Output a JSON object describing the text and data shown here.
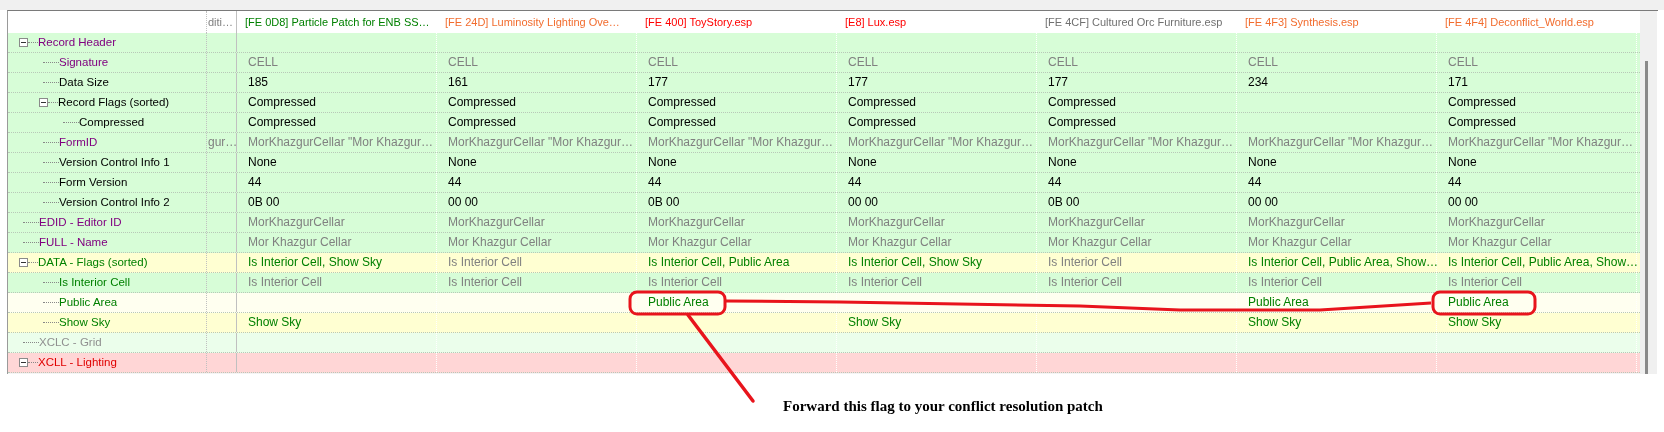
{
  "columns": [
    {
      "label": "diti…",
      "color": "#808080"
    },
    {
      "label": "[FE 0D8] Particle Patch for ENB SS…",
      "color": "#008000"
    },
    {
      "label": "[FE 24D] Luminosity Lighting Ove…",
      "color": "#f26c2e"
    },
    {
      "label": "[FE 400] ToyStory.esp",
      "color": "#ff0000"
    },
    {
      "label": "[E8] Lux.esp",
      "color": "#ff0000"
    },
    {
      "label": "[FE 4CF] Cultured Orc Furniture.esp",
      "color": "#707070"
    },
    {
      "label": "[FE 4F3] Synthesis.esp",
      "color": "#f26c2e"
    },
    {
      "label": "[FE 4F4] Deconflict_World.esp",
      "color": "#f26c2e"
    }
  ],
  "rows": [
    {
      "label": "Record Header",
      "color": "#800080",
      "kind": "match",
      "expanded": true,
      "cells": [
        null,
        null,
        null,
        null,
        null,
        null,
        null,
        null
      ],
      "children": [
        {
          "label": "Signature",
          "color": "#800080",
          "kind": "match",
          "cells": [
            null,
            {
              "text": "CELL",
              "color": "#808080"
            },
            {
              "text": "CELL",
              "color": "#808080"
            },
            {
              "text": "CELL",
              "color": "#808080"
            },
            {
              "text": "CELL",
              "color": "#808080"
            },
            {
              "text": "CELL",
              "color": "#808080"
            },
            {
              "text": "CELL",
              "color": "#808080"
            },
            {
              "text": "CELL",
              "color": "#808080"
            }
          ]
        },
        {
          "label": "Data Size",
          "color": "#000000",
          "kind": "match",
          "cells": [
            null,
            {
              "text": "185",
              "color": "#000000"
            },
            {
              "text": "161",
              "color": "#000000"
            },
            {
              "text": "177",
              "color": "#000000"
            },
            {
              "text": "177",
              "color": "#000000"
            },
            {
              "text": "177",
              "color": "#000000"
            },
            {
              "text": "234",
              "color": "#000000"
            },
            {
              "text": "171",
              "color": "#000000"
            }
          ]
        },
        {
          "label": "Record Flags (sorted)",
          "color": "#000000",
          "kind": "match",
          "expanded": true,
          "cells": [
            null,
            {
              "text": "Compressed",
              "color": "#000000"
            },
            {
              "text": "Compressed",
              "color": "#000000"
            },
            {
              "text": "Compressed",
              "color": "#000000"
            },
            {
              "text": "Compressed",
              "color": "#000000"
            },
            {
              "text": "Compressed",
              "color": "#000000"
            },
            null,
            {
              "text": "Compressed",
              "color": "#000000"
            }
          ],
          "children": [
            {
              "label": "Compressed",
              "color": "#000000",
              "kind": "match",
              "cells": [
                null,
                {
                  "text": "Compressed",
                  "color": "#000000"
                },
                {
                  "text": "Compressed",
                  "color": "#000000"
                },
                {
                  "text": "Compressed",
                  "color": "#000000"
                },
                {
                  "text": "Compressed",
                  "color": "#000000"
                },
                {
                  "text": "Compressed",
                  "color": "#000000"
                },
                null,
                {
                  "text": "Compressed",
                  "color": "#000000"
                }
              ]
            }
          ]
        },
        {
          "label": "FormID",
          "color": "#800080",
          "kind": "match",
          "cells": [
            {
              "text": "gur…",
              "color": "#808080"
            },
            {
              "text": "MorKhazgurCellar \"Mor Khazgur…",
              "color": "#808080"
            },
            {
              "text": "MorKhazgurCellar \"Mor Khazgur…",
              "color": "#808080"
            },
            {
              "text": "MorKhazgurCellar \"Mor Khazgur…",
              "color": "#808080"
            },
            {
              "text": "MorKhazgurCellar \"Mor Khazgur…",
              "color": "#808080"
            },
            {
              "text": "MorKhazgurCellar \"Mor Khazgur…",
              "color": "#808080"
            },
            {
              "text": "MorKhazgurCellar \"Mor Khazgur…",
              "color": "#808080"
            },
            {
              "text": "MorKhazgurCellar \"Mor Khazgur…",
              "color": "#808080"
            }
          ]
        },
        {
          "label": "Version Control Info 1",
          "color": "#000000",
          "kind": "match",
          "cells": [
            null,
            {
              "text": "None",
              "color": "#000000"
            },
            {
              "text": "None",
              "color": "#000000"
            },
            {
              "text": "None",
              "color": "#000000"
            },
            {
              "text": "None",
              "color": "#000000"
            },
            {
              "text": "None",
              "color": "#000000"
            },
            {
              "text": "None",
              "color": "#000000"
            },
            {
              "text": "None",
              "color": "#000000"
            }
          ]
        },
        {
          "label": "Form Version",
          "color": "#000000",
          "kind": "match",
          "cells": [
            null,
            {
              "text": "44",
              "color": "#000000"
            },
            {
              "text": "44",
              "color": "#000000"
            },
            {
              "text": "44",
              "color": "#000000"
            },
            {
              "text": "44",
              "color": "#000000"
            },
            {
              "text": "44",
              "color": "#000000"
            },
            {
              "text": "44",
              "color": "#000000"
            },
            {
              "text": "44",
              "color": "#000000"
            }
          ]
        },
        {
          "label": "Version Control Info 2",
          "color": "#000000",
          "kind": "match",
          "cells": [
            null,
            {
              "text": "0B 00",
              "color": "#000000"
            },
            {
              "text": "00 00",
              "color": "#000000"
            },
            {
              "text": "0B 00",
              "color": "#000000"
            },
            {
              "text": "00 00",
              "color": "#000000"
            },
            {
              "text": "0B 00",
              "color": "#000000"
            },
            {
              "text": "00 00",
              "color": "#000000"
            },
            {
              "text": "00 00",
              "color": "#000000"
            }
          ]
        }
      ]
    },
    {
      "label": "EDID - Editor ID",
      "color": "#800080",
      "kind": "match",
      "cells": [
        null,
        {
          "text": "MorKhazgurCellar",
          "color": "#808080"
        },
        {
          "text": "MorKhazgurCellar",
          "color": "#808080"
        },
        {
          "text": "MorKhazgurCellar",
          "color": "#808080"
        },
        {
          "text": "MorKhazgurCellar",
          "color": "#808080"
        },
        {
          "text": "MorKhazgurCellar",
          "color": "#808080"
        },
        {
          "text": "MorKhazgurCellar",
          "color": "#808080"
        },
        {
          "text": "MorKhazgurCellar",
          "color": "#808080"
        }
      ]
    },
    {
      "label": "FULL - Name",
      "color": "#800080",
      "kind": "match",
      "cells": [
        null,
        {
          "text": "Mor Khazgur Cellar",
          "color": "#808080"
        },
        {
          "text": "Mor Khazgur Cellar",
          "color": "#808080"
        },
        {
          "text": "Mor Khazgur Cellar",
          "color": "#808080"
        },
        {
          "text": "Mor Khazgur Cellar",
          "color": "#808080"
        },
        {
          "text": "Mor Khazgur Cellar",
          "color": "#808080"
        },
        {
          "text": "Mor Khazgur Cellar",
          "color": "#808080"
        },
        {
          "text": "Mor Khazgur Cellar",
          "color": "#808080"
        }
      ]
    },
    {
      "label": "DATA - Flags (sorted)",
      "color": "#008000",
      "kind": "conflict",
      "expanded": true,
      "cells": [
        null,
        {
          "text": "Is Interior Cell, Show Sky",
          "color": "#008000"
        },
        {
          "text": "Is Interior Cell",
          "color": "#808080"
        },
        {
          "text": "Is Interior Cell, Public Area",
          "color": "#008000"
        },
        {
          "text": "Is Interior Cell, Show Sky",
          "color": "#008000"
        },
        {
          "text": "Is Interior Cell",
          "color": "#808080"
        },
        {
          "text": "Is Interior Cell, Public Area, Show…",
          "color": "#008000"
        },
        {
          "text": "Is Interior Cell, Public Area, Show…",
          "color": "#008000"
        }
      ],
      "children": [
        {
          "label": "Is Interior Cell",
          "color": "#008000",
          "kind": "match",
          "cells": [
            null,
            {
              "text": "Is Interior Cell",
              "color": "#808080"
            },
            {
              "text": "Is Interior Cell",
              "color": "#808080"
            },
            {
              "text": "Is Interior Cell",
              "color": "#808080"
            },
            {
              "text": "Is Interior Cell",
              "color": "#808080"
            },
            {
              "text": "Is Interior Cell",
              "color": "#808080"
            },
            {
              "text": "Is Interior Cell",
              "color": "#808080"
            },
            {
              "text": "Is Interior Cell",
              "color": "#808080"
            }
          ]
        },
        {
          "label": "Public Area",
          "color": "#008000",
          "kind": "pale",
          "cells": [
            null,
            null,
            null,
            {
              "text": "Public Area",
              "color": "#008000"
            },
            null,
            null,
            {
              "text": "Public Area",
              "color": "#008000"
            },
            {
              "text": "Public Area",
              "color": "#008000"
            }
          ]
        },
        {
          "label": "Show Sky",
          "color": "#008000",
          "kind": "conflict",
          "cells": [
            null,
            {
              "text": "Show Sky",
              "color": "#008000"
            },
            null,
            null,
            {
              "text": "Show Sky",
              "color": "#008000"
            },
            null,
            {
              "text": "Show Sky",
              "color": "#008000"
            },
            {
              "text": "Show Sky",
              "color": "#008000"
            }
          ]
        }
      ]
    },
    {
      "label": "XCLC - Grid",
      "color": "#909090",
      "kind": "empty",
      "cells": [
        null,
        null,
        null,
        null,
        null,
        null,
        null,
        null
      ]
    },
    {
      "label": "XCLL - Lighting",
      "color": "#e00000",
      "kind": "critical",
      "expanded": true,
      "cells": [
        null,
        null,
        null,
        null,
        null,
        null,
        null,
        null
      ]
    }
  ],
  "annotation": {
    "text": "Forward this flag to your conflict resolution patch"
  }
}
